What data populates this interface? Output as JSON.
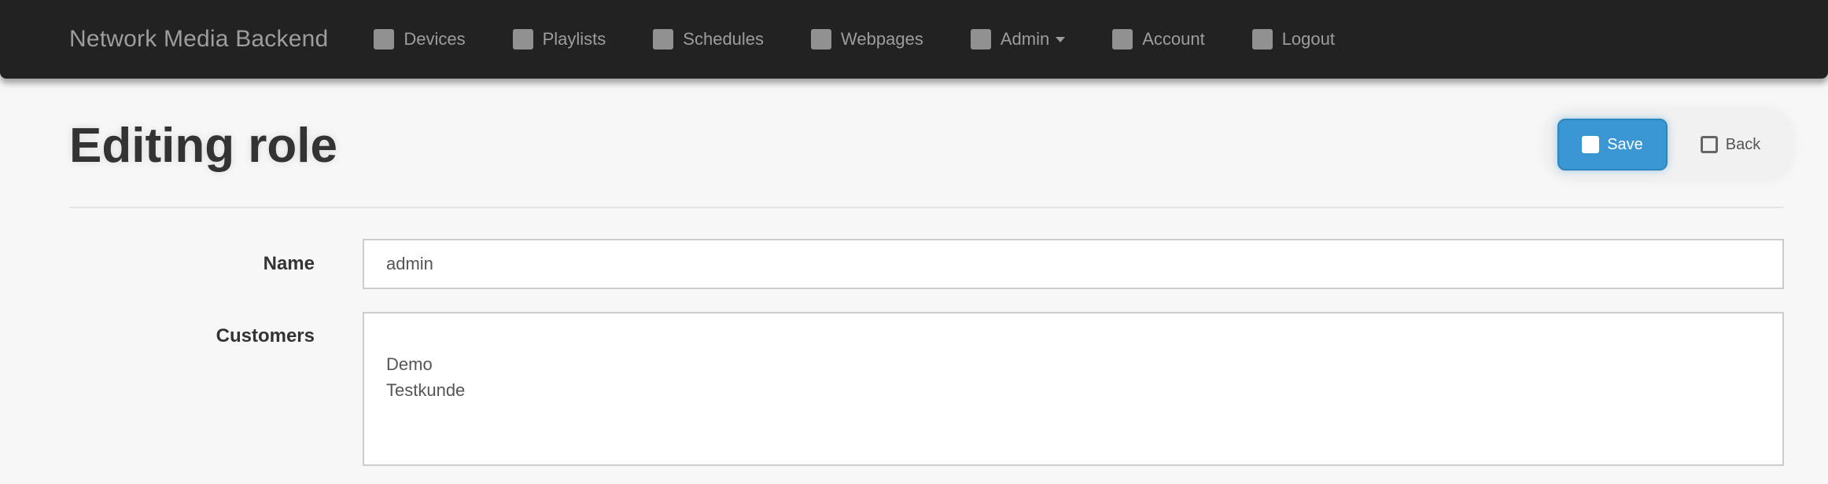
{
  "navbar": {
    "brand": "Network Media Backend",
    "items": [
      {
        "label": "Devices",
        "icon": "desktop-icon",
        "dropdown": false
      },
      {
        "label": "Playlists",
        "icon": "list-icon",
        "dropdown": false
      },
      {
        "label": "Schedules",
        "icon": "calendar-icon",
        "dropdown": false
      },
      {
        "label": "Webpages",
        "icon": "globe-icon",
        "dropdown": false
      },
      {
        "label": "Admin",
        "icon": "cog-icon",
        "dropdown": true
      },
      {
        "label": "Account",
        "icon": "user-icon",
        "dropdown": false
      },
      {
        "label": "Logout",
        "icon": "logout-icon",
        "dropdown": false
      }
    ]
  },
  "page": {
    "title": "Editing role"
  },
  "actions": {
    "save_label": "Save",
    "back_label": "Back"
  },
  "form": {
    "name_label": "Name",
    "name_value": "admin",
    "customers_label": "Customers",
    "customers": [
      "Demo",
      "Testkunde"
    ]
  },
  "colors": {
    "navbar_bg": "#222222",
    "primary_button": "#3b97d3",
    "page_bg": "#f7f7f7"
  }
}
